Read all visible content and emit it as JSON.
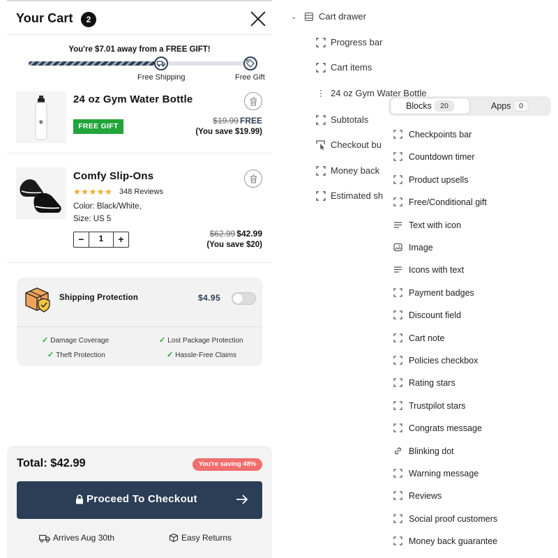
{
  "cart": {
    "title": "Your Cart",
    "count": "2",
    "gift_message": "You're $7.01 away from a FREE GIFT!",
    "progress": 0.62,
    "milestones": [
      "Free Shipping",
      "Free Gift"
    ],
    "items": [
      {
        "name": "24 oz Gym Water Bottle",
        "tag": "FREE GIFT",
        "old_price": "$19.99",
        "new_price": "FREE",
        "savings": "(You save $19.99)"
      },
      {
        "name": "Comfy Slip-Ons",
        "stars": "★★★★★",
        "reviews": "348 Reviews",
        "variant_color": "Color: Black/White,",
        "variant_size": "Size: US 5",
        "qty_minus": "−",
        "quantity": "1",
        "qty_plus": "+",
        "old_price": "$62.99",
        "new_price": "$42.99",
        "savings": "(You save $20)"
      }
    ],
    "protection": {
      "title": "Shipping Protection",
      "price": "$4.95",
      "enabled": false,
      "features": [
        "Damage Coverage",
        "Lost Package Protection",
        "Theft Protection",
        "Hassle-Free Claims"
      ]
    },
    "footer": {
      "total": "Total: $42.99",
      "saving_badge": "You're saving 48%",
      "checkout_label": "Proceed To Checkout",
      "arrival": "Arrives Aug 30th",
      "returns": "Easy Returns"
    }
  },
  "editor": {
    "tree": {
      "root": "Cart drawer",
      "children": [
        "Progress bar",
        "Cart items",
        "24 oz Gym Water Bottle",
        "Subtotals",
        "Checkout bu",
        "Money back",
        "Estimated sh"
      ]
    },
    "popup": {
      "tabs": [
        {
          "label": "Blocks",
          "count": "20"
        },
        {
          "label": "Apps",
          "count": "0"
        }
      ],
      "blocks": [
        "Checkpoints bar",
        "Countdown timer",
        "Product upsells",
        "Free/Conditional gift",
        "Text with icon",
        "Image",
        "Icons with text",
        "Payment badges",
        "Discount field",
        "Cart note",
        "Policies checkbox",
        "Rating stars",
        "Trustpilot stars",
        "Congrats message",
        "Blinking dot",
        "Warning message",
        "Reviews",
        "Social proof customers",
        "Money back guarantee"
      ]
    }
  },
  "colors": {
    "navy": "#2c3e56",
    "gift_green": "#22a43a",
    "saving_red": "#f26d6d",
    "star_gold": "#f5a623"
  }
}
